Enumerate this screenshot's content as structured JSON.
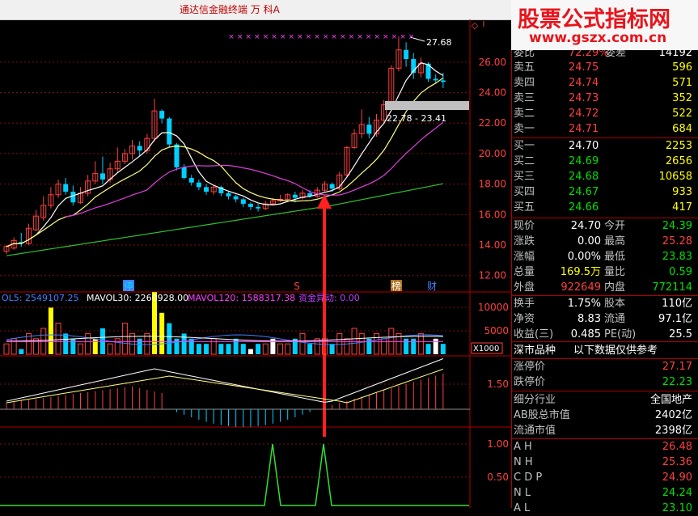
{
  "window": {
    "title": "通达信金融终端   万 科A"
  },
  "watermark": {
    "brand": "股票公式指标网",
    "url": "www.gszx.com.cn"
  },
  "colors": {
    "up": "#ff4040",
    "down": "#00e000",
    "neutral": "#ffffff",
    "accent_yellow": "#ffff00",
    "ma_magenta": "#e040e0",
    "ma_green": "#30c030"
  },
  "kline": {
    "price_ticks": [
      "26.00",
      "24.00",
      "22.00",
      "20.00",
      "18.00",
      "16.00",
      "14.00",
      "12.00"
    ],
    "high_label": "27.68",
    "range_label": "22.78 - 23.41",
    "markers": [
      "停",
      "S",
      "榜",
      "财"
    ]
  },
  "volume": {
    "legend": [
      {
        "text": "OL5: 2549107.25",
        "color": "#4080ff"
      },
      {
        "text": "MAVOL30: 2260928.00",
        "color": "#ffffff"
      },
      {
        "text": "MAVOL120: 1588317.38",
        "color": "#ff40ff"
      },
      {
        "text": "资金异动: 0.00",
        "color": "#c040ff"
      }
    ],
    "ticks": [
      "10000",
      "5000"
    ],
    "unit": "X1000"
  },
  "macd": {
    "ticks": [
      "1.50"
    ]
  },
  "signal": {
    "ticks": [
      "1.00",
      "0.50"
    ]
  },
  "quote": {
    "partial_top": {
      "label": "委比",
      "value": "72.29%",
      "label2": "委差",
      "value2": "14192"
    },
    "asks": [
      {
        "label": "卖五",
        "price": "24.75",
        "vol": "596"
      },
      {
        "label": "卖四",
        "price": "24.74",
        "vol": "571"
      },
      {
        "label": "卖三",
        "price": "24.73",
        "vol": "352"
      },
      {
        "label": "卖二",
        "price": "24.72",
        "vol": "522"
      },
      {
        "label": "卖一",
        "price": "24.71",
        "vol": "684"
      }
    ],
    "bids": [
      {
        "label": "买一",
        "price": "24.70",
        "vol": "2253"
      },
      {
        "label": "买二",
        "price": "24.69",
        "vol": "2656"
      },
      {
        "label": "买三",
        "price": "24.68",
        "vol": "10658"
      },
      {
        "label": "买四",
        "price": "24.67",
        "vol": "933"
      },
      {
        "label": "买五",
        "price": "24.66",
        "vol": "417"
      }
    ],
    "stats": [
      {
        "l1": "现价",
        "v1": "24.70",
        "l2": "今开",
        "v2": "24.39",
        "c1": "white",
        "c2": "green"
      },
      {
        "l1": "涨跌",
        "v1": "0.00",
        "l2": "最高",
        "v2": "25.28",
        "c1": "white",
        "c2": "red"
      },
      {
        "l1": "涨幅",
        "v1": "0.00%",
        "l2": "最低",
        "v2": "23.83",
        "c1": "white",
        "c2": "green"
      },
      {
        "l1": "总量",
        "v1": "169.5万",
        "l2": "量比",
        "v2": "0.59",
        "c1": "yellow",
        "c2": "green"
      },
      {
        "l1": "外盘",
        "v1": "922649",
        "l2": "内盘",
        "v2": "772114",
        "c1": "red",
        "c2": "green"
      }
    ],
    "fundamentals": [
      {
        "l1": "换手",
        "v1": "1.75%",
        "l2": "股本",
        "v2": "110亿"
      },
      {
        "l1": "净资",
        "v1": "8.83",
        "l2": "流通",
        "v2": "97.1亿"
      },
      {
        "l1": "收益(三)",
        "v1": "0.485",
        "l2": "PE(动)",
        "v2": "25.5"
      }
    ],
    "info_header": {
      "left": "深市品种",
      "right": "以下数据仅供参考"
    },
    "limits": [
      {
        "label": "涨停价",
        "value": "27.17"
      },
      {
        "label": "跌停价",
        "value": "22.23"
      }
    ],
    "industry": {
      "label": "细分行业",
      "value": "全国地产"
    },
    "caps": [
      {
        "label": "AB股总市值",
        "value": "2402亿"
      },
      {
        "label": "流通市值",
        "value": "2398亿"
      }
    ],
    "related": [
      {
        "label": "A H",
        "value": "26.48",
        "color": "red"
      },
      {
        "label": "N H",
        "value": "25.36",
        "color": "red"
      },
      {
        "label": "C D P",
        "value": "24.90",
        "color": "red"
      },
      {
        "label": "N L",
        "value": "24.24",
        "color": "green"
      },
      {
        "label": "A L",
        "value": "23.10",
        "color": "green"
      }
    ]
  }
}
